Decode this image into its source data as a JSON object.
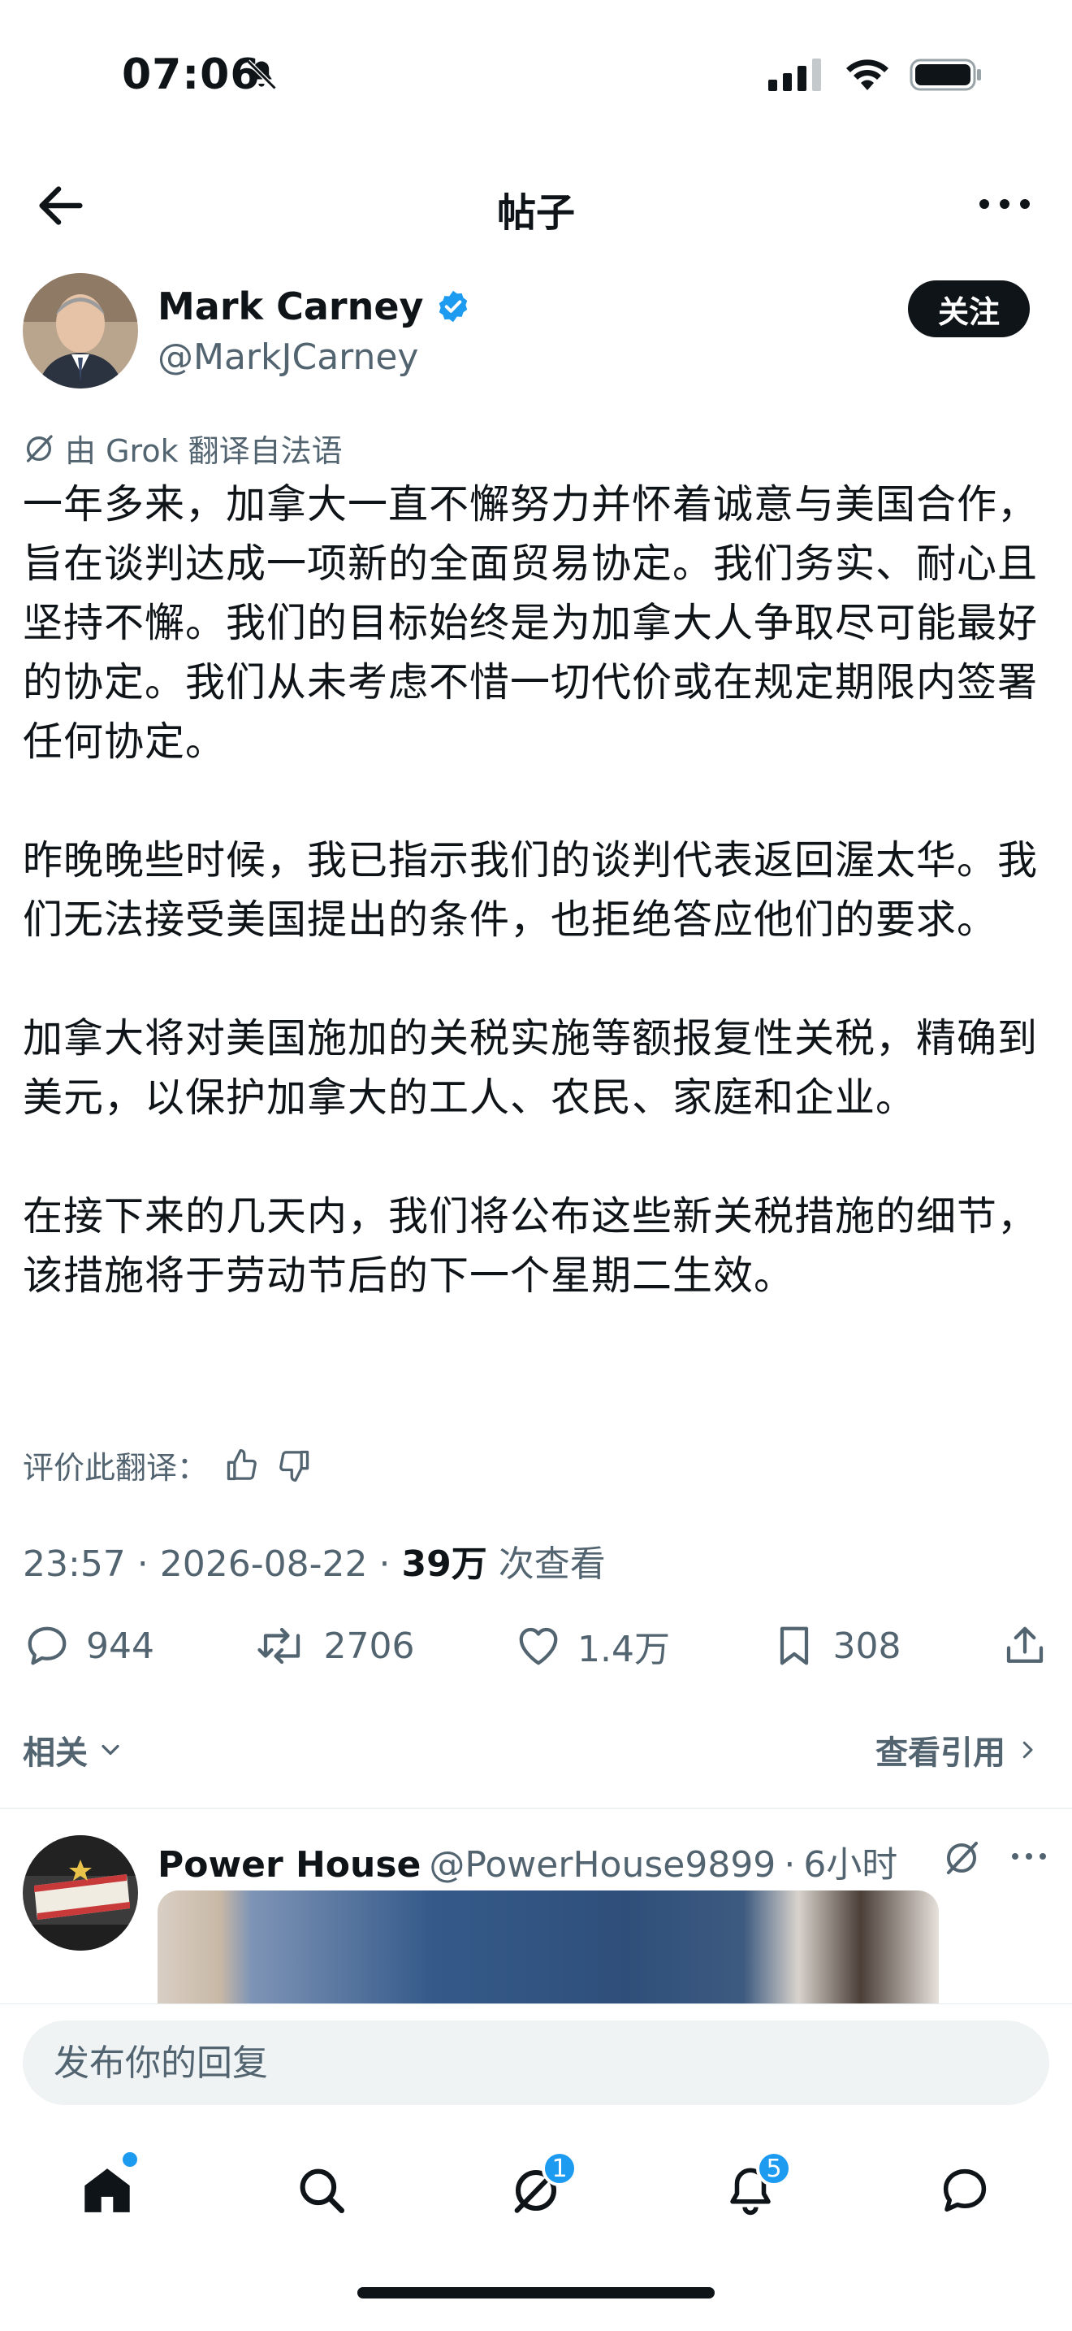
{
  "status_bar": {
    "time": "07:06"
  },
  "header": {
    "title": "帖子"
  },
  "post": {
    "author_name": "Mark Carney",
    "author_handle": "@MarkJCarney",
    "follow_label": "关注",
    "translated_note": "由 Grok 翻译自法语",
    "paragraphs": [
      "一年多来，加拿大一直不懈努力并怀着诚意与美国合作，旨在谈判达成一项新的全面贸易协定。我们务实、耐心且坚持不懈。我们的目标始终是为加拿大人争取尽可能最好的协定。我们从未考虑不惜一切代价或在规定期限内签署任何协定。",
      "昨晚晚些时候，我已指示我们的谈判代表返回渥太华。我们无法接受美国提出的条件，也拒绝答应他们的要求。",
      "加拿大将对美国施加的关税实施等额报复性关税，精确到美元，以保护加拿大的工人、农民、家庭和企业。",
      "在接下来的几天内，我们将公布这些新关税措施的细节，该措施将于劳动节后的下一个星期二生效。"
    ],
    "rate_label": "评价此翻译：",
    "time": "23:57",
    "date": "2026-08-22",
    "views_count": "39万",
    "views_label": "次查看",
    "replies": "944",
    "reposts": "2706",
    "likes": "1.4万",
    "bookmarks": "308"
  },
  "related_label": "相关",
  "quotes_label": "查看引用",
  "reply": {
    "name": "Power House",
    "handle": "@PowerHouse9899",
    "time": "6小时"
  },
  "compose": {
    "placeholder": "发布你的回复"
  },
  "tabbar": {
    "messages_badge": "1",
    "notifications_badge": "5"
  },
  "colors": {
    "accent": "#1d9bf0",
    "text": "#0f1419",
    "secondary": "#536471"
  }
}
